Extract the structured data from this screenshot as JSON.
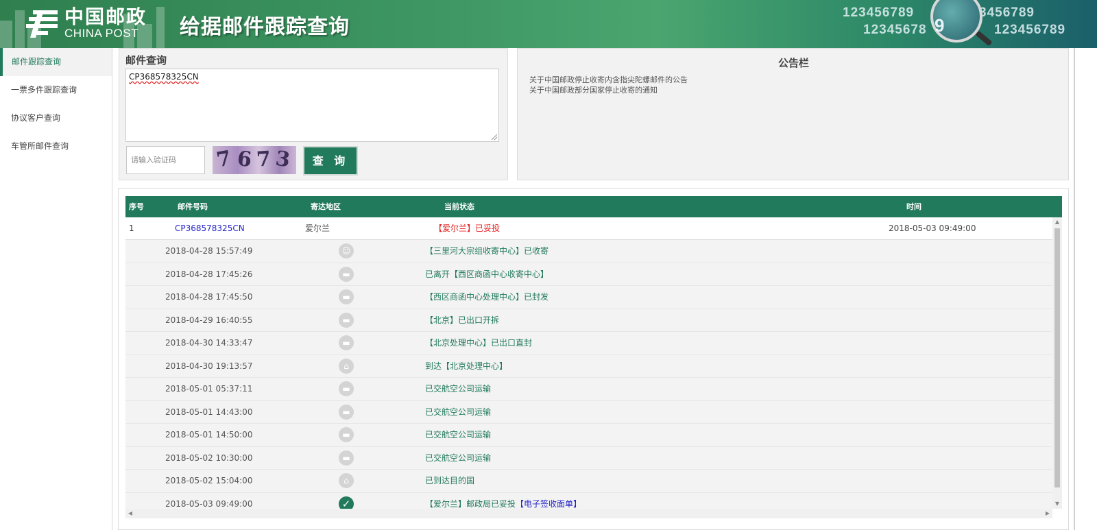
{
  "header": {
    "logo_cn": "中国邮政",
    "logo_en": "CHINA POST",
    "site_title": "给据邮件跟踪查询",
    "deco_numbers": [
      "123456789",
      "12345678",
      "3456789",
      "123456789"
    ],
    "magnifier_digit": "9",
    "brand_color": "#217a5b"
  },
  "sidebar": {
    "items": [
      {
        "label": "邮件跟踪查询"
      },
      {
        "label": "一票多件跟踪查询"
      },
      {
        "label": "协议客户查询"
      },
      {
        "label": "车管所邮件查询"
      }
    ]
  },
  "query": {
    "title": "邮件查询",
    "textarea_value": "CP368578325CN",
    "captcha_placeholder": "请输入验证码",
    "captcha_chars": [
      "7",
      "6",
      "7",
      "3"
    ],
    "button_label": "查 询"
  },
  "notice": {
    "title": "公告栏",
    "links": [
      "关于中国邮政停止收寄内含指尖陀螺邮件的公告",
      "关于中国邮政部分国家停止收寄的通知"
    ]
  },
  "results": {
    "headers": {
      "no": "序号",
      "mail_no": "邮件号码",
      "destination": "寄达地区",
      "status": "当前状态",
      "time": "时间"
    },
    "main_row": {
      "no": "1",
      "mail_no": "CP368578325CN",
      "destination": "爱尔兰",
      "status": "【爱尔兰】已妥投",
      "time": "2018-05-03 09:49:00"
    },
    "details": [
      {
        "time": "2018-04-28 15:57:49",
        "icon": "courier-icon",
        "text": "【三里河大宗组收寄中心】已收寄"
      },
      {
        "time": "2018-04-28 17:45:26",
        "icon": "truck-icon",
        "text": "已离开【西区商函中心收寄中心】"
      },
      {
        "time": "2018-04-28 17:45:50",
        "icon": "truck-icon",
        "text": "【西区商函中心处理中心】已封发"
      },
      {
        "time": "2018-04-29 16:40:55",
        "icon": "truck-icon",
        "text": "【北京】已出口开拆"
      },
      {
        "time": "2018-04-30 14:33:47",
        "icon": "truck-icon",
        "text": "【北京处理中心】已出口直封"
      },
      {
        "time": "2018-04-30 19:13:57",
        "icon": "arrival-icon",
        "text": "到达【北京处理中心】"
      },
      {
        "time": "2018-05-01 05:37:11",
        "icon": "truck-icon",
        "text": "已交航空公司运输"
      },
      {
        "time": "2018-05-01 14:43:00",
        "icon": "truck-icon",
        "text": "已交航空公司运输"
      },
      {
        "time": "2018-05-01 14:50:00",
        "icon": "truck-icon",
        "text": "已交航空公司运输"
      },
      {
        "time": "2018-05-02 10:30:00",
        "icon": "truck-icon",
        "text": "已交航空公司运输"
      },
      {
        "time": "2018-05-02 15:04:00",
        "icon": "arrival-icon",
        "text": "已到达目的国"
      },
      {
        "time": "2018-05-03 09:49:00",
        "icon": "checkmark-icon",
        "text": "【爱尔兰】邮政局已妥投",
        "link": "【电子签收面单】"
      }
    ]
  }
}
